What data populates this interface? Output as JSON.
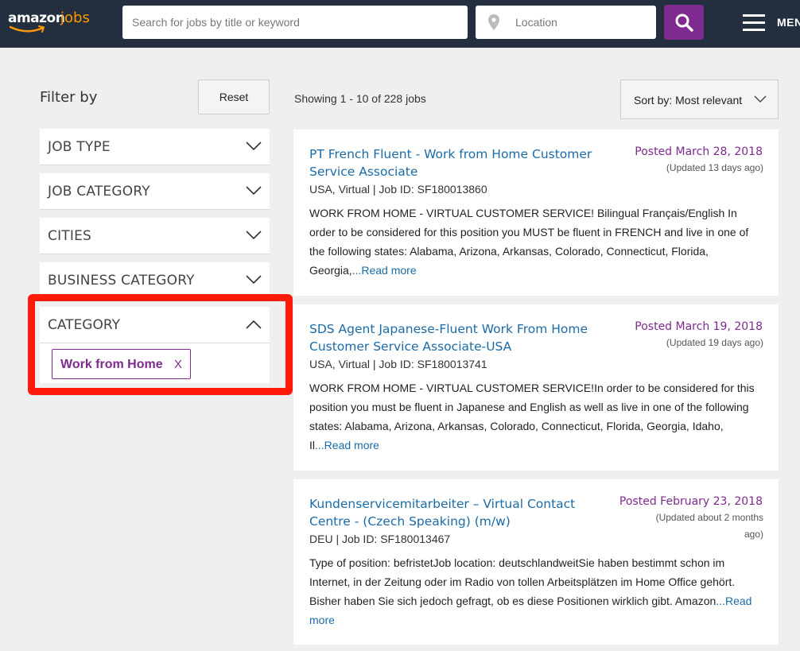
{
  "header": {
    "logo_amazon": "amazon",
    "logo_jobs": "jobs",
    "search_placeholder": "Search for jobs by title or keyword",
    "location_placeholder": "Location",
    "menu_label": "MENU",
    "search_button_color": "#7e2a8e"
  },
  "sidebar": {
    "filter_title": "Filter by",
    "reset_label": "Reset",
    "filters": [
      {
        "label": "JOB TYPE",
        "icon": "chevron-down-icon"
      },
      {
        "label": "JOB CATEGORY",
        "icon": "chevron-down-icon"
      },
      {
        "label": "CITIES",
        "icon": "chevron-down-icon"
      },
      {
        "label": "BUSINESS CATEGORY",
        "icon": "chevron-down-icon"
      }
    ],
    "category": {
      "label": "CATEGORY",
      "icon": "chevron-up-icon",
      "selected_tag": "Work from Home",
      "remove_label": "X"
    },
    "highlight_color": "#ff1a0a"
  },
  "results": {
    "showing_text": "Showing 1 - 10 of 228 jobs",
    "sort_label": "Sort by: Most relevant",
    "jobs": [
      {
        "title": "PT French Fluent - Work from Home Customer Service Associate",
        "meta": "USA, Virtual | Job ID: SF180013860",
        "posted": "Posted March 28, 2018",
        "updated": "(Updated 13 days ago)",
        "description": "WORK FROM HOME - VIRTUAL CUSTOMER SERVICE!  Bilingual Français/English In order to be considered for this position you MUST be fluent in FRENCH and live in one of the following states: Alabama, Arizona, Arkansas, Colorado, Connecticut, Florida, Georgia,",
        "read_more": "...Read more"
      },
      {
        "title": "SDS Agent Japanese-Fluent Work From Home Customer Service Associate-USA",
        "meta": "USA, Virtual | Job ID: SF180013741",
        "posted": "Posted March 19, 2018",
        "updated": "(Updated 19 days ago)",
        "description": "WORK FROM HOME - VIRTUAL CUSTOMER SERVICE!In order to be considered for this position you must be fluent in Japanese and English as well as live in one of the following states: Alabama, Arizona, Arkansas, Colorado, Connecticut, Florida, Georgia, Idaho, Il",
        "read_more": "...Read more"
      },
      {
        "title": "Kundenservicemitarbeiter – Virtual Contact Centre - (Czech Speaking) (m/w)",
        "meta": "DEU | Job ID: SF180013467",
        "posted": "Posted February 23, 2018",
        "updated": "(Updated about 2 months ago)",
        "description": "Type of position: befristetJob location: deutschlandweitSie haben bestimmt schon im Internet, in der Zeitung oder im Radio von tollen Arbeitsplätzen im Home Office gehört. Bisher haben Sie sich jedoch gefragt, ob es diese Positionen wirklich gibt. Amazon",
        "read_more": "...Read more"
      }
    ]
  }
}
